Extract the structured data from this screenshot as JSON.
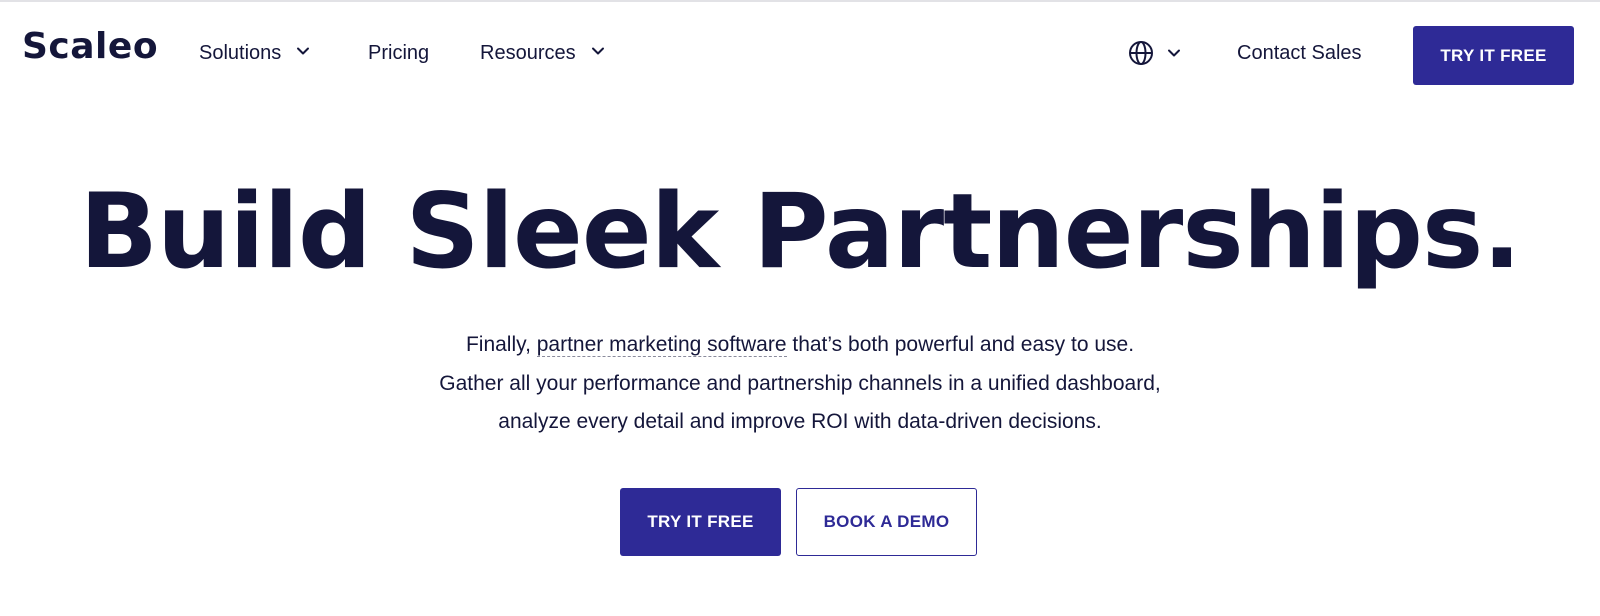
{
  "header": {
    "logo": "Scaleo",
    "nav": {
      "solutions": "Solutions",
      "pricing": "Pricing",
      "resources": "Resources"
    },
    "language_icon": "globe-icon",
    "contact_sales": "Contact Sales",
    "cta": "TRY IT FREE"
  },
  "hero": {
    "title": "Build Sleek Partnerships.",
    "line1_before": "Finally, ",
    "line1_link": "partner marketing software",
    "line1_after": " that’s both powerful and easy to use.",
    "line2": "Gather all your performance and partnership channels in a unified dashboard,",
    "line3": "analyze every detail and improve ROI with data-driven decisions.",
    "primary_button": "TRY IT FREE",
    "secondary_button": "BOOK A DEMO"
  },
  "colors": {
    "brand": "#2e2a96",
    "text": "#14163a"
  }
}
